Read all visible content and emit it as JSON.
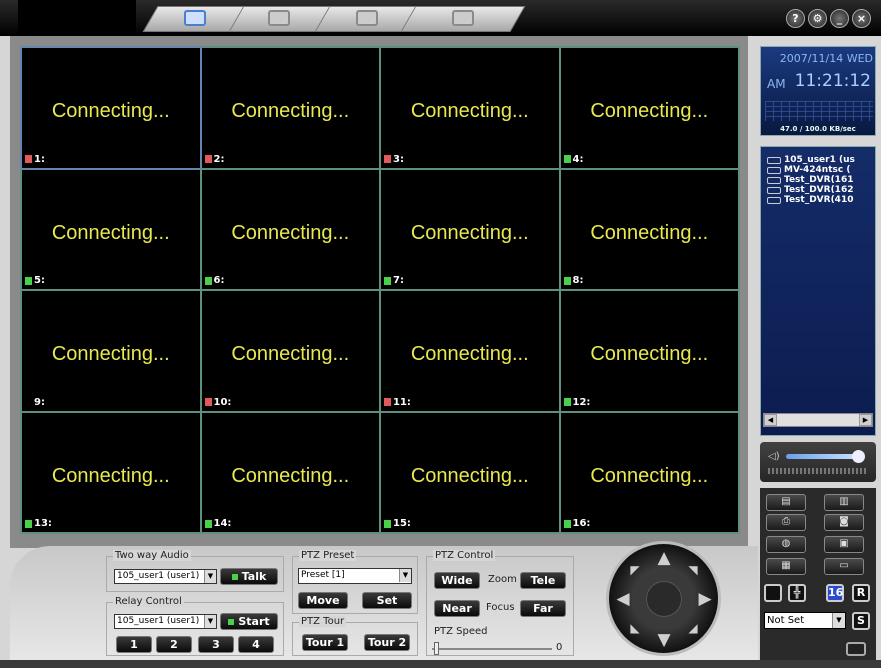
{
  "window": {
    "tabs": [
      {
        "name": "live-view",
        "icon": "camera-icon",
        "active": true
      },
      {
        "name": "search",
        "icon": "search-dvr-icon",
        "active": false
      },
      {
        "name": "remote",
        "icon": "monitor-search-icon",
        "active": false
      },
      {
        "name": "setup",
        "icon": "setup-icon",
        "active": false
      }
    ],
    "controls": {
      "help": "?",
      "settings": "⚙",
      "minimize": "_",
      "close": "×"
    }
  },
  "cameras": [
    {
      "label": "1:",
      "status": "Connecting...",
      "indicator": "red"
    },
    {
      "label": "2:",
      "status": "Connecting...",
      "indicator": "red"
    },
    {
      "label": "3:",
      "status": "Connecting...",
      "indicator": "red"
    },
    {
      "label": "4:",
      "status": "Connecting...",
      "indicator": "green"
    },
    {
      "label": "5:",
      "status": "Connecting...",
      "indicator": "green"
    },
    {
      "label": "6:",
      "status": "Connecting...",
      "indicator": "green"
    },
    {
      "label": "7:",
      "status": "Connecting...",
      "indicator": "green"
    },
    {
      "label": "8:",
      "status": "Connecting...",
      "indicator": "green"
    },
    {
      "label": "9:",
      "status": "Connecting...",
      "indicator": "none"
    },
    {
      "label": "10:",
      "status": "Connecting...",
      "indicator": "red"
    },
    {
      "label": "11:",
      "status": "Connecting...",
      "indicator": "red"
    },
    {
      "label": "12:",
      "status": "Connecting...",
      "indicator": "green"
    },
    {
      "label": "13:",
      "status": "Connecting...",
      "indicator": "green"
    },
    {
      "label": "14:",
      "status": "Connecting...",
      "indicator": "green"
    },
    {
      "label": "15:",
      "status": "Connecting...",
      "indicator": "green"
    },
    {
      "label": "16:",
      "status": "Connecting...",
      "indicator": "green"
    }
  ],
  "clock": {
    "date": "2007/11/14 WED",
    "ampm": "AM",
    "time": "11:21:12",
    "rate": "47.0 / 100.0 KB/sec"
  },
  "devices": [
    "105_user1 (us",
    "MV-424ntsc (",
    "Test_DVR(161",
    "Test_DVR(162",
    "Test_DVR(410"
  ],
  "audio": {
    "title": "Two way Audio",
    "selected": "105_user1 (user1)",
    "talk": "Talk"
  },
  "relay": {
    "title": "Relay Control",
    "selected": "105_user1 (user1)",
    "start": "Start",
    "buttons": [
      "1",
      "2",
      "3",
      "4"
    ]
  },
  "preset": {
    "title": "PTZ Preset",
    "selected": "Preset [1]",
    "move": "Move",
    "set": "Set"
  },
  "tour": {
    "title": "PTZ Tour",
    "tour1": "Tour 1",
    "tour2": "Tour 2"
  },
  "ptz": {
    "title": "PTZ Control",
    "wide": "Wide",
    "zoom": "Zoom",
    "tele": "Tele",
    "near": "Near",
    "focus": "Focus",
    "far": "Far",
    "speed": "PTZ Speed",
    "speed_value": "0"
  },
  "layout": {
    "single": "",
    "quad": "",
    "sixteen": "16",
    "r": "R",
    "select": "Not Set",
    "s": "S"
  }
}
